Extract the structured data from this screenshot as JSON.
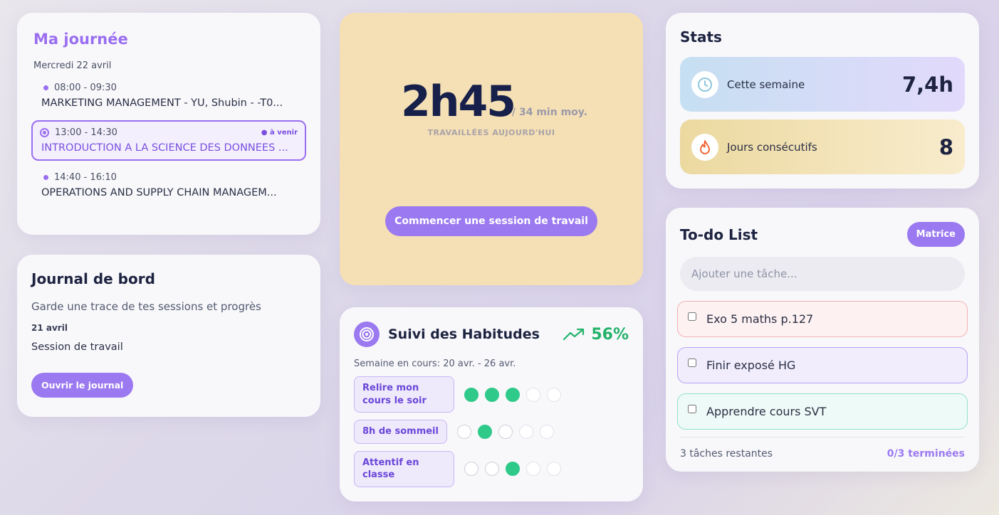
{
  "day": {
    "title": "Ma journée",
    "date": "Mercredi 22 avril",
    "events": [
      {
        "time": "08:00 - 09:30",
        "name": "MARKETING MANAGEMENT - YU, Shubin - -T0..."
      },
      {
        "time": "13:00 - 14:30",
        "name": "INTRODUCTION A LA SCIENCE DES DONNEES ...",
        "badge": "● à venir"
      },
      {
        "time": "14:40 - 16:10",
        "name": "OPERATIONS AND SUPPLY CHAIN MANAGEM..."
      }
    ]
  },
  "journal": {
    "title": "Journal de bord",
    "subtitle": "Garde une trace de tes sessions et progrès",
    "entry_date": "21 avril",
    "entry_text": "Session de travail",
    "open_button": "Ouvrir le journal"
  },
  "timer": {
    "value": "2h45",
    "average": "/ 34 min moy.",
    "caption": "TRAVAILLÉES AUJOURD'HUI",
    "start_button": "Commencer une session de travail",
    "background": "#f5dfb5"
  },
  "habits": {
    "title": "Suivi des Habitudes",
    "percent": "56%",
    "week": "Semaine en cours: 20 avr. - 26 avr.",
    "rows": [
      {
        "label": "Relire mon cours le soir",
        "checks": [
          1,
          1,
          1,
          0,
          0
        ]
      },
      {
        "label": "8h de sommeil",
        "checks": [
          0,
          1,
          0,
          0,
          0
        ]
      },
      {
        "label": "Attentif en classe",
        "checks": [
          0,
          0,
          1,
          0,
          0
        ]
      }
    ],
    "accent": "#9b79f0",
    "check_color": "#2fc98a"
  },
  "stats": {
    "title": "Stats",
    "week_label": "Cette semaine",
    "week_value": "7,4h",
    "streak_label": "Jours consécutifs",
    "streak_value": "8"
  },
  "todo": {
    "title": "To-do List",
    "matrix_button": "Matrice",
    "input_placeholder": "Ajouter une tâche...",
    "items": [
      {
        "text": "Exo 5 maths p.127",
        "checked": false
      },
      {
        "text": "Finir exposé HG",
        "checked": false
      },
      {
        "text": "Apprendre cours SVT",
        "checked": false
      }
    ],
    "remaining": "3 tâches restantes",
    "done": "0/3 terminées"
  }
}
